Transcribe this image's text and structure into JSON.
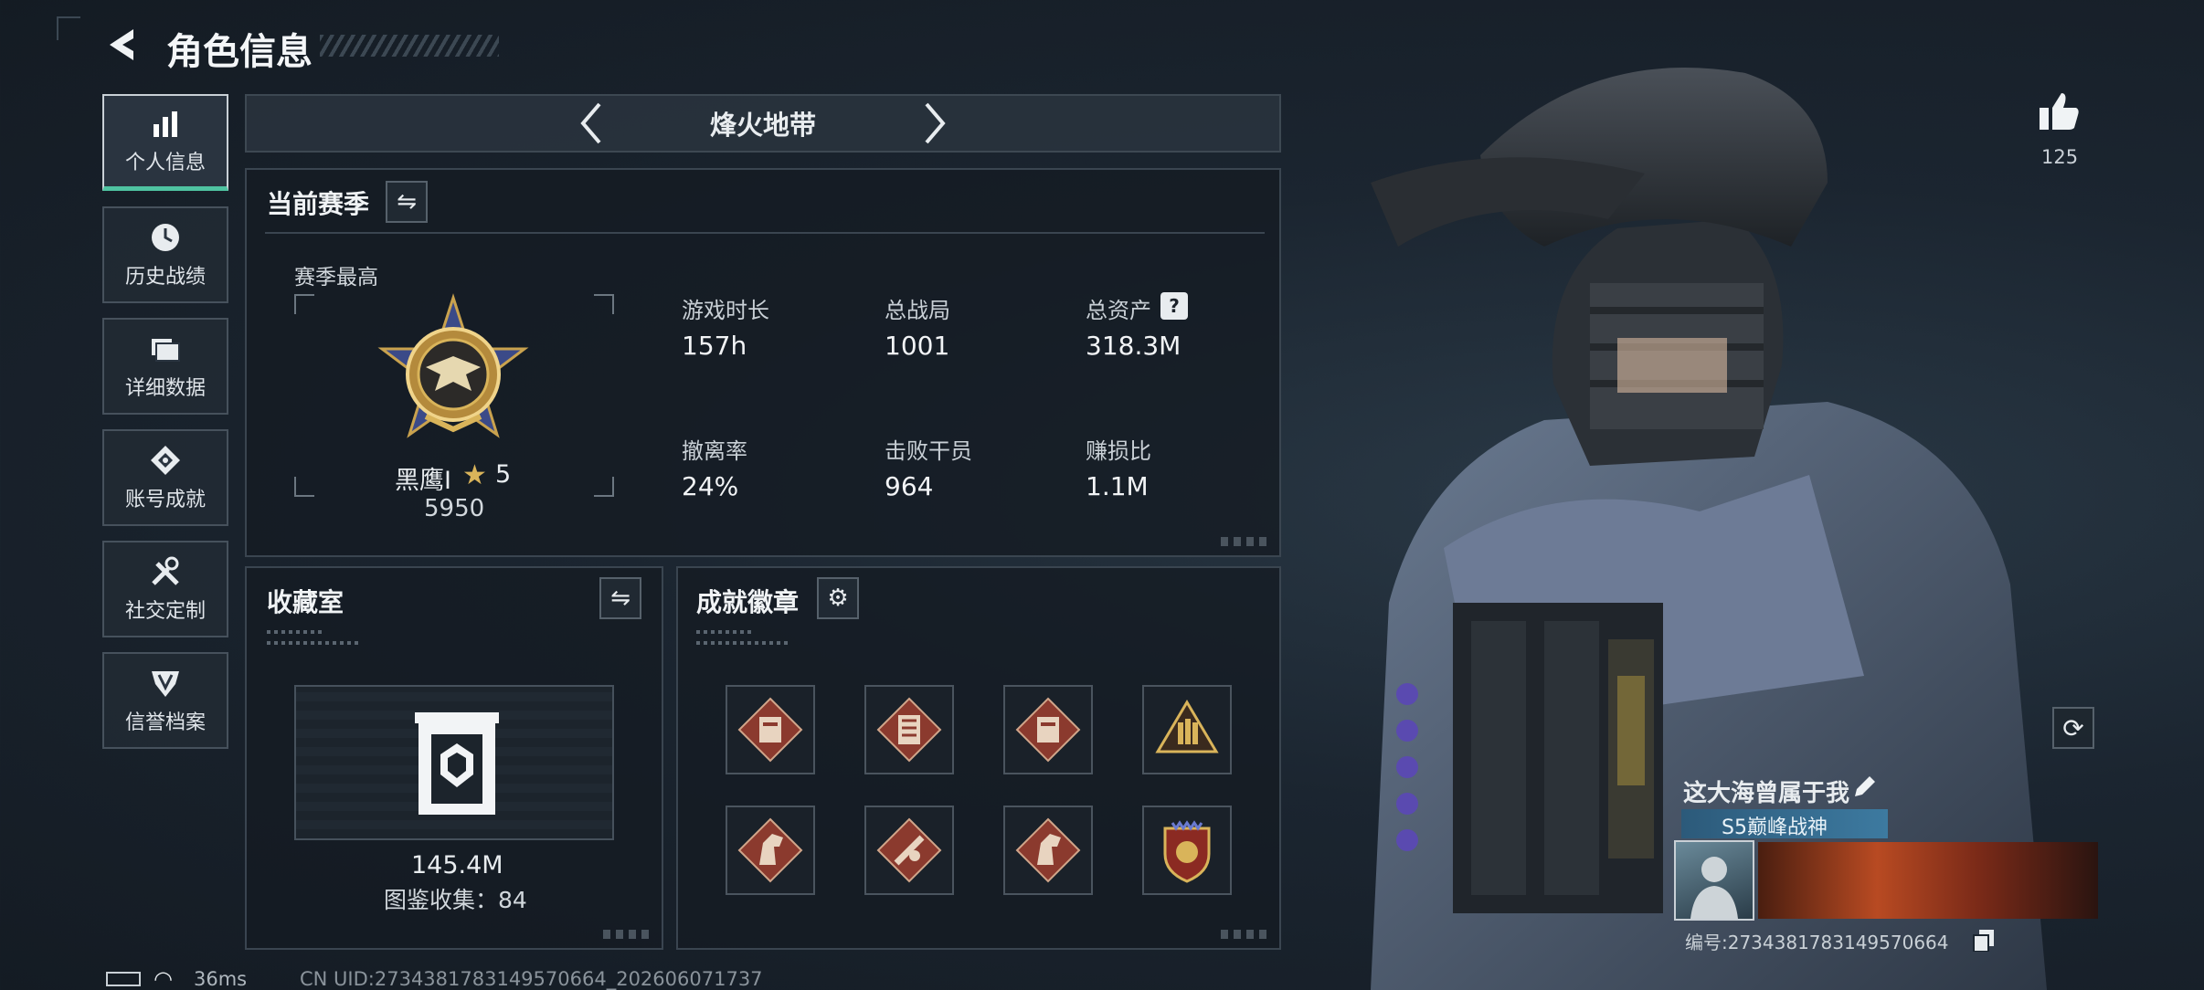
{
  "header": {
    "title": "角色信息",
    "back_icon": "back-arrow-icon"
  },
  "sidebar": {
    "items": [
      {
        "label": "个人信息",
        "icon": "bar-chart-icon",
        "active": true
      },
      {
        "label": "历史战绩",
        "icon": "history-icon"
      },
      {
        "label": "详细数据",
        "icon": "folder-icon"
      },
      {
        "label": "账号成就",
        "icon": "achievement-icon"
      },
      {
        "label": "社交定制",
        "icon": "tools-icon"
      },
      {
        "label": "信誉档案",
        "icon": "reputation-icon"
      }
    ]
  },
  "mode_selector": {
    "title": "烽火地带",
    "prev_icon": "chevron-left-icon",
    "next_icon": "chevron-right-icon"
  },
  "season": {
    "title": "当前赛季",
    "best_label": "赛季最高",
    "rank_name": "黑鹰I",
    "rank_stars": "5",
    "rank_score": "5950",
    "stats": [
      {
        "label": "游戏时长",
        "value": "157h"
      },
      {
        "label": "总战局",
        "value": "1001"
      },
      {
        "label": "总资产",
        "value": "318.3M",
        "help": "?"
      },
      {
        "label": "撤离率",
        "value": "24%"
      },
      {
        "label": "击败干员",
        "value": "964"
      },
      {
        "label": "赚损比",
        "value": "1.1M"
      }
    ]
  },
  "collection": {
    "title": "收藏室",
    "value": "145.4M",
    "catalog_label": "图鉴收集：84"
  },
  "achievements": {
    "title": "成就徽章",
    "badge_count": 8
  },
  "like": {
    "count": "125"
  },
  "profile": {
    "name": "这大海曾属于我",
    "title_badge": "S5巅峰战神",
    "id_label": "编号:2734381783149570664"
  },
  "status_bar": {
    "ping": "36ms",
    "uid": "CN UID:2734381783149570664_202606071737"
  },
  "colors": {
    "accent": "#4fc3a1",
    "gold": "#d9b45a",
    "badge_red": "#8b3a2e"
  }
}
